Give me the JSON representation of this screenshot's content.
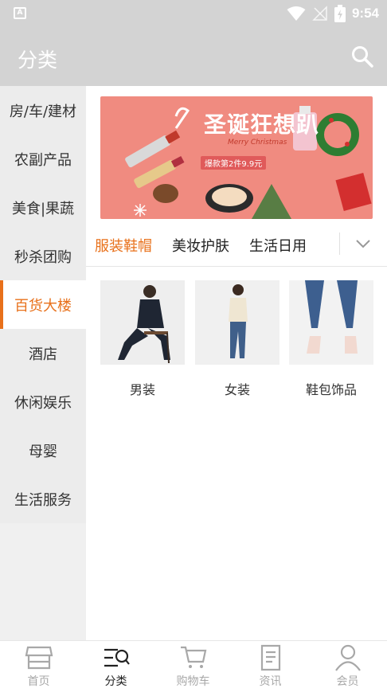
{
  "status_bar": {
    "time": "9:54",
    "left_badge": "A"
  },
  "app_bar": {
    "title": "分类"
  },
  "sidebar": {
    "items": [
      {
        "label": "房/车/建材",
        "active": false
      },
      {
        "label": "农副产品",
        "active": false
      },
      {
        "label": "美食|果蔬",
        "active": false
      },
      {
        "label": "秒杀团购",
        "active": false
      },
      {
        "label": "百货大楼",
        "active": true
      },
      {
        "label": "酒店",
        "active": false
      },
      {
        "label": "休闲娱乐",
        "active": false
      },
      {
        "label": "母婴",
        "active": false
      },
      {
        "label": "生活服务",
        "active": false
      }
    ]
  },
  "banner": {
    "headline": "圣诞狂想趴",
    "subline": "Merry Christmas",
    "promo": "爆款第2件9.9元"
  },
  "subtabs": {
    "items": [
      {
        "label": "服装鞋帽",
        "active": true
      },
      {
        "label": "美妆护肤",
        "active": false
      },
      {
        "label": "生活日用",
        "active": false
      }
    ]
  },
  "products": [
    {
      "label": "男装"
    },
    {
      "label": "女装"
    },
    {
      "label": "鞋包饰品"
    }
  ],
  "bottom_nav": {
    "items": [
      {
        "label": "首页",
        "icon": "store-icon",
        "active": false
      },
      {
        "label": "分类",
        "icon": "category-search-icon",
        "active": true
      },
      {
        "label": "购物车",
        "icon": "cart-icon",
        "active": false
      },
      {
        "label": "资讯",
        "icon": "news-icon",
        "active": false
      },
      {
        "label": "会员",
        "icon": "user-icon",
        "active": false
      }
    ]
  },
  "colors": {
    "accent": "#e8701a",
    "header": "#d3d3d3",
    "banner_bg": "#f08b80"
  }
}
